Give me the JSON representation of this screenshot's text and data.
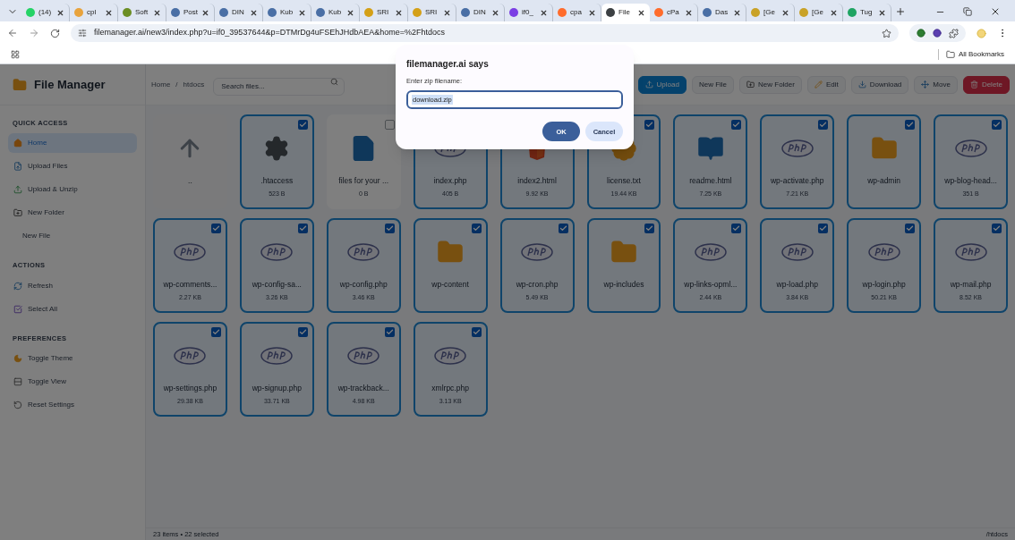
{
  "browser": {
    "tabs": [
      {
        "label": "(14)",
        "selected": false,
        "color": "#25d366"
      },
      {
        "label": "cpl",
        "selected": false,
        "color": "#e8a33d"
      },
      {
        "label": "Soft",
        "selected": false,
        "color": "#6b8e23"
      },
      {
        "label": "Post",
        "selected": false,
        "color": "#4a6fa5"
      },
      {
        "label": "DIN",
        "selected": false,
        "color": "#4a6fa5"
      },
      {
        "label": "Kub",
        "selected": false,
        "color": "#4a6fa5"
      },
      {
        "label": "Kub",
        "selected": false,
        "color": "#4a6fa5"
      },
      {
        "label": "SRI",
        "selected": false,
        "color": "#d4a017"
      },
      {
        "label": "SRI",
        "selected": false,
        "color": "#d4a017"
      },
      {
        "label": "DIN",
        "selected": false,
        "color": "#4a6fa5"
      },
      {
        "label": "if0_",
        "selected": false,
        "color": "#7b3fe4"
      },
      {
        "label": "cpa",
        "selected": false,
        "color": "#ff6c2c"
      },
      {
        "label": "File",
        "selected": true,
        "color": "#3c4043"
      },
      {
        "label": "cPa",
        "selected": false,
        "color": "#ff6c2c"
      },
      {
        "label": "Das",
        "selected": false,
        "color": "#4a6fa5"
      },
      {
        "label": "[Ge",
        "selected": false,
        "color": "#c9a227"
      },
      {
        "label": "[Ge",
        "selected": false,
        "color": "#c9a227"
      },
      {
        "label": "Tug",
        "selected": false,
        "color": "#1fa463"
      }
    ],
    "url": "filemanager.ai/new3/index.php?u=if0_39537644&p=DTMrDg4uFSEhJHdbAEA&home=%2Fhtdocs",
    "bookmarks_label": "All Bookmarks"
  },
  "dialog": {
    "title": "filemanager.ai says",
    "prompt": "Enter zip filename:",
    "value": "download.zip",
    "buttons": [
      {
        "label": "OK",
        "kind": "primary"
      },
      {
        "label": "Cancel",
        "kind": "secondary"
      }
    ]
  },
  "app": {
    "title": "File Manager",
    "breadcrumbs": [
      "Home",
      "htdocs"
    ],
    "breadcrumb_separator": "/",
    "search": {
      "placeholder": "Search files..."
    },
    "toolbar": [
      {
        "label": "Upload",
        "kind": "primary"
      },
      {
        "label": "New File",
        "kind": "default"
      },
      {
        "label": "New Folder",
        "kind": "default"
      },
      {
        "label": "Edit",
        "kind": "default"
      },
      {
        "label": "Download",
        "kind": "default"
      },
      {
        "label": "Move",
        "kind": "default"
      },
      {
        "label": "Delete",
        "kind": "danger"
      }
    ],
    "sidebar": [
      {
        "title": "QUICK ACCESS",
        "items": [
          {
            "label": "Home",
            "selected": true
          },
          {
            "label": "Upload Files",
            "selected": false
          },
          {
            "label": "Upload & Unzip",
            "selected": false
          },
          {
            "label": "New Folder",
            "selected": false
          },
          {
            "label": "New File",
            "selected": false
          }
        ]
      },
      {
        "title": "ACTIONS",
        "items": [
          {
            "label": "Refresh",
            "selected": false
          },
          {
            "label": "Select All",
            "selected": false
          }
        ]
      },
      {
        "title": "PREFERENCES",
        "items": [
          {
            "label": "Toggle Theme",
            "selected": false
          },
          {
            "label": "Toggle View",
            "selected": false
          },
          {
            "label": "Reset Settings",
            "selected": false
          }
        ]
      }
    ],
    "files": [
      {
        "name": "..",
        "kind": "parent"
      },
      {
        "name": ".htaccess",
        "size": "523 B",
        "kind": "config",
        "selected": true
      },
      {
        "name": "files for your ...",
        "size": "0 B",
        "kind": "file",
        "selected": false
      },
      {
        "name": "index.php",
        "size": "405 B",
        "kind": "php",
        "selected": true
      },
      {
        "name": "index2.html",
        "size": "9.92 KB",
        "kind": "html",
        "selected": true
      },
      {
        "name": "license.txt",
        "size": "19.44 KB",
        "kind": "license",
        "selected": true
      },
      {
        "name": "readme.html",
        "size": "7.25 KB",
        "kind": "book",
        "selected": true
      },
      {
        "name": "wp-activate.php",
        "size": "7.21 KB",
        "kind": "php",
        "selected": true
      },
      {
        "name": "wp-admin",
        "kind": "folder",
        "selected": true
      },
      {
        "name": "wp-blog-head...",
        "size": "351 B",
        "kind": "php",
        "selected": true
      },
      {
        "name": "wp-comments...",
        "size": "2.27 KB",
        "kind": "php",
        "selected": true
      },
      {
        "name": "wp-config-sa...",
        "size": "3.26 KB",
        "kind": "php",
        "selected": true
      },
      {
        "name": "wp-config.php",
        "size": "3.46 KB",
        "kind": "php",
        "selected": true
      },
      {
        "name": "wp-content",
        "kind": "folder",
        "selected": true
      },
      {
        "name": "wp-cron.php",
        "size": "5.49 KB",
        "kind": "php",
        "selected": true
      },
      {
        "name": "wp-includes",
        "kind": "folder",
        "selected": true
      },
      {
        "name": "wp-links-opml...",
        "size": "2.44 KB",
        "kind": "php",
        "selected": true
      },
      {
        "name": "wp-load.php",
        "size": "3.84 KB",
        "kind": "php",
        "selected": true
      },
      {
        "name": "wp-login.php",
        "size": "50.21 KB",
        "kind": "php",
        "selected": true
      },
      {
        "name": "wp-mail.php",
        "size": "8.52 KB",
        "kind": "php",
        "selected": true
      },
      {
        "name": "wp-settings.php",
        "size": "29.38 KB",
        "kind": "php",
        "selected": true
      },
      {
        "name": "wp-signup.php",
        "size": "33.71 KB",
        "kind": "php",
        "selected": true
      },
      {
        "name": "wp-trackback...",
        "size": "4.98 KB",
        "kind": "php",
        "selected": true
      },
      {
        "name": "xmlrpc.php",
        "size": "3.13 KB",
        "kind": "php",
        "selected": true
      }
    ],
    "status": {
      "summary": "23 items • 22 selected",
      "path": "/htdocs"
    }
  }
}
